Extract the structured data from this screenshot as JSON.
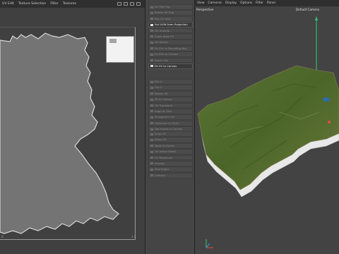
{
  "uv_editor": {
    "menu": [
      "UV Edit",
      "Texture Selection",
      "Filter",
      "Textures"
    ],
    "coord_zero": "0",
    "coord_one": "1.0"
  },
  "commands": {
    "group1": [
      "UV Peel Top",
      "Rotate 90 Deg",
      "Flip UV Axis",
      "Set UVW from Projection",
      "UV Unwrap",
      "Cubic Area Fill",
      "UV Seams",
      "Fit UVs to Bounding Box",
      "Fit UVs to Canvas",
      "Stack UVs"
    ],
    "group2": [
      "Flip U",
      "Flip V",
      "Rotate 90",
      "Fit to Canvas",
      "UV Transform",
      "Align to Grid",
      "Straighten UVs",
      "Optimize UV Shell",
      "Normalize to Canvas"
    ],
    "group3": [
      "Snap UV",
      "Relax UV",
      "Weld UV Points",
      "UV Island Select",
      "UV Projection",
      "Sewing",
      "Sew Edges",
      "Unstitch"
    ],
    "active": [
      "Set UVW from Projection",
      "Fit UV to Canvas"
    ]
  },
  "viewport": {
    "menu": [
      "View",
      "Cameras",
      "Display",
      "Options",
      "Filter",
      "Panel"
    ],
    "label": "Perspective",
    "camera": "Default Camera"
  },
  "colors": {
    "map_fill": "#747474",
    "map_outline": "#d8d8d8",
    "terrain_green": "#4f6a2c",
    "axis_y": "#2ecc71",
    "axis_x": "#e74c3c",
    "axis_z": "#3498db"
  }
}
